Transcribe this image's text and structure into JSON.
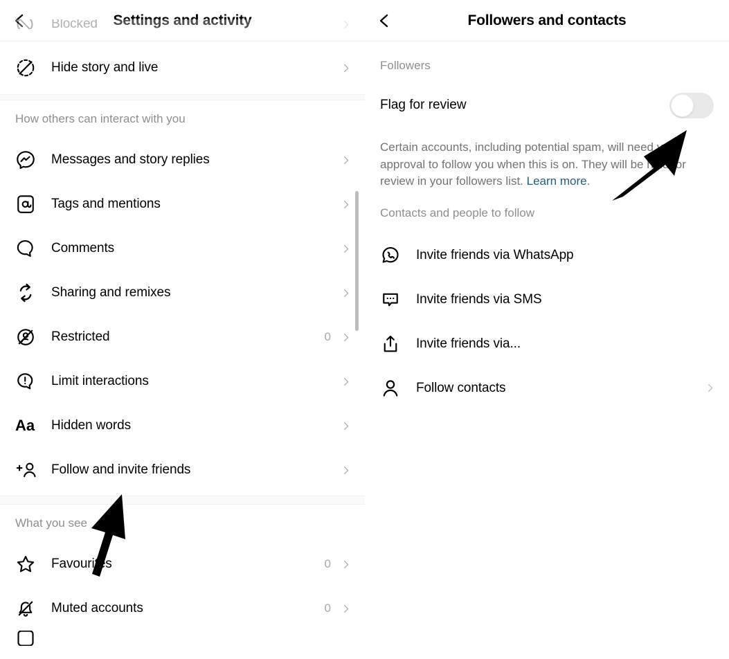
{
  "left_panel": {
    "header": {
      "back_icon": "chevron-left-icon",
      "title": "Settings and activity"
    },
    "clipped_top_row": {
      "label": "Blocked",
      "icon": "blocked-icon"
    },
    "rows_top": [
      {
        "label": "Hide story and live",
        "icon": "hide-story-icon",
        "count": "",
        "chevron": true
      }
    ],
    "section_interact": {
      "title": "How others can interact with you",
      "rows": [
        {
          "label": "Messages and story replies",
          "icon": "messenger-icon",
          "count": "",
          "chevron": true
        },
        {
          "label": "Tags and mentions",
          "icon": "at-mention-icon",
          "count": "",
          "chevron": true
        },
        {
          "label": "Comments",
          "icon": "comment-bubble-icon",
          "count": "",
          "chevron": true
        },
        {
          "label": "Sharing and remixes",
          "icon": "remix-icon",
          "count": "",
          "chevron": true
        },
        {
          "label": "Restricted",
          "icon": "restricted-icon",
          "count": "0",
          "chevron": true
        },
        {
          "label": "Limit interactions",
          "icon": "limit-interactions-icon",
          "count": "",
          "chevron": true
        },
        {
          "label": "Hidden words",
          "icon": "hidden-words-icon",
          "count": "",
          "chevron": true
        },
        {
          "label": "Follow and invite friends",
          "icon": "add-person-icon",
          "count": "",
          "chevron": true
        }
      ]
    },
    "section_whatyousee": {
      "title": "What you see",
      "rows": [
        {
          "label": "Favourites",
          "icon": "star-icon",
          "count": "0",
          "chevron": true
        },
        {
          "label": "Muted accounts",
          "icon": "muted-bell-icon",
          "count": "0",
          "chevron": true
        }
      ]
    },
    "scrollbar": {
      "visible": true,
      "color": "#bdbdbd"
    }
  },
  "right_panel": {
    "header": {
      "back_icon": "chevron-left-icon",
      "title": "Followers and contacts"
    },
    "section_followers": {
      "title": "Followers",
      "toggle": {
        "label": "Flag for review",
        "state": "off",
        "track_color": "#e9e9ea",
        "knob_color": "#ffffff"
      },
      "description_text": "Certain accounts, including potential spam, will need your approval to follow you when this is on. They will be held for review in your followers list. ",
      "description_link": "Learn more",
      "description_suffix": ".",
      "link_color": "#2c5a82"
    },
    "section_contacts": {
      "title": "Contacts and people to follow",
      "rows": [
        {
          "label": "Invite friends via WhatsApp",
          "icon": "whatsapp-icon",
          "chevron": false
        },
        {
          "label": "Invite friends via SMS",
          "icon": "sms-bubble-icon",
          "chevron": false
        },
        {
          "label": "Invite friends via...",
          "icon": "share-upload-icon",
          "chevron": false
        },
        {
          "label": "Follow contacts",
          "icon": "person-icon",
          "chevron": true
        }
      ]
    }
  },
  "annotations": [
    {
      "name": "arrow-to-follow-and-invite-friends",
      "color": "#000000"
    },
    {
      "name": "arrow-to-flag-for-review-toggle",
      "color": "#000000"
    }
  ]
}
